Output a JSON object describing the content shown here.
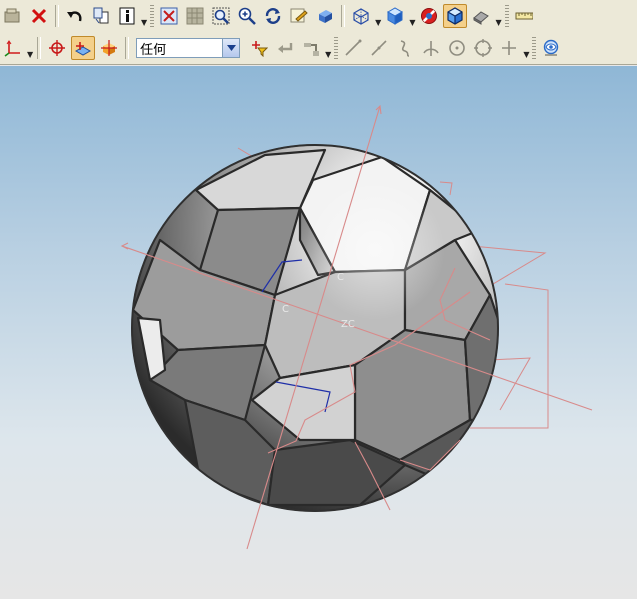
{
  "toolbar_row1": {
    "buttons": [
      {
        "name": "open-part-button",
        "icon": "open-part-icon"
      },
      {
        "name": "delete-button",
        "icon": "close-icon"
      },
      {
        "name": "undo-button",
        "icon": "undo-icon"
      },
      {
        "name": "copy-object-button",
        "icon": "copy-icon"
      },
      {
        "name": "info-button",
        "icon": "info-icon"
      },
      {
        "name": "fit-view-button",
        "icon": "fit-icon"
      },
      {
        "name": "refresh-view-button",
        "icon": "grid-icon"
      },
      {
        "name": "zoom-window-button",
        "icon": "zoom-window-icon"
      },
      {
        "name": "zoom-in-out-button",
        "icon": "zoom-icon"
      },
      {
        "name": "rotate-view-button",
        "icon": "rotate-icon"
      },
      {
        "name": "save-view-button",
        "icon": "save-view-icon"
      },
      {
        "name": "shaded-view-button",
        "icon": "cube-icon"
      },
      {
        "name": "wireframe-view-button",
        "icon": "wireframe-cube-icon"
      },
      {
        "name": "isometric-view-button",
        "icon": "isometric-cube-icon"
      },
      {
        "name": "hide-object-button",
        "icon": "no-entry-icon"
      },
      {
        "name": "shaded-edges-button",
        "icon": "shaded-cube-icon"
      },
      {
        "name": "display-mode-button",
        "icon": "eraser-icon"
      },
      {
        "name": "measure-button",
        "icon": "ruler-icon"
      }
    ]
  },
  "toolbar_row2": {
    "filter_combo": {
      "value": "任何"
    },
    "buttons": [
      {
        "name": "wcs-orient-button",
        "icon": "axes-icon"
      },
      {
        "name": "snap-point-button",
        "icon": "crosshair-icon"
      },
      {
        "name": "select-feature-button",
        "icon": "feature-select-icon"
      },
      {
        "name": "select-body-button",
        "icon": "body-select-icon"
      },
      {
        "name": "selection-filter-button",
        "icon": "filter-icon"
      },
      {
        "name": "deselect-button",
        "icon": "return-arrow-icon"
      },
      {
        "name": "snap-settings-button",
        "icon": "snap-settings-icon"
      },
      {
        "name": "snap-end-point-button",
        "icon": "line-icon"
      },
      {
        "name": "snap-mid-point-button",
        "icon": "line-mid-icon"
      },
      {
        "name": "snap-control-point-button",
        "icon": "curve-icon"
      },
      {
        "name": "snap-intersection-button",
        "icon": "intersection-icon"
      },
      {
        "name": "snap-arc-center-button",
        "icon": "circle-center-icon"
      },
      {
        "name": "snap-quadrant-button",
        "icon": "circle-quadrant-icon"
      },
      {
        "name": "snap-existing-point-button",
        "icon": "plus-icon"
      },
      {
        "name": "view-manager-button",
        "icon": "view-manager-icon"
      }
    ]
  },
  "viewport": {
    "axis_labels": [
      "C",
      "C",
      "ZC"
    ],
    "colors": {
      "background_top": "#8fb7d6",
      "background_bottom": "#e6e6e6",
      "datum": "#d88a8a",
      "sketch": "#1f2fa8"
    }
  }
}
